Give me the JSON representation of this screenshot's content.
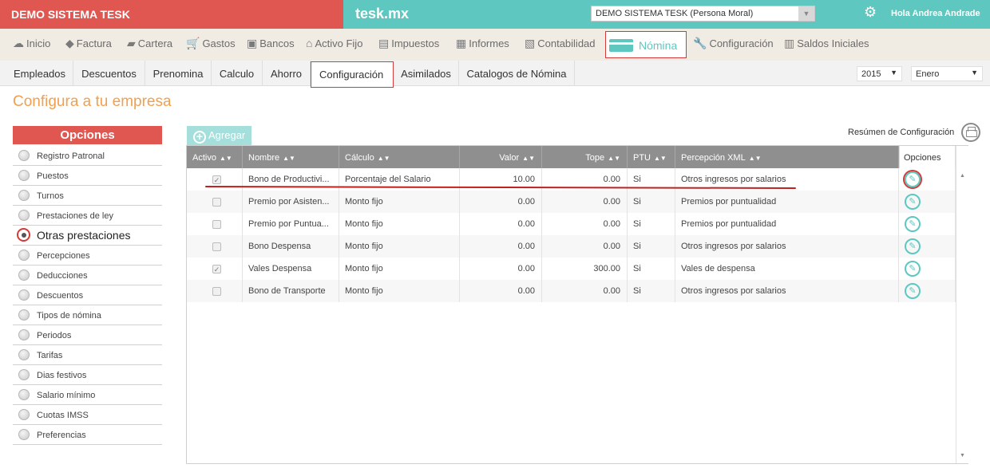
{
  "topbar": {
    "company_left": "DEMO SISTEMA TESK",
    "brand": "tesk.mx",
    "company_select": "DEMO SISTEMA TESK (Persona Moral)",
    "greeting": "Hola Andrea Andrade"
  },
  "mainmenu": [
    {
      "label": "Inicio",
      "icon": "cloud-icon"
    },
    {
      "label": "Factura",
      "icon": "tag-icon"
    },
    {
      "label": "Cartera",
      "icon": "wallet-icon"
    },
    {
      "label": "Gastos",
      "icon": "cart-icon"
    },
    {
      "label": "Bancos",
      "icon": "safe-icon"
    },
    {
      "label": "Activo Fijo",
      "icon": "house-icon"
    },
    {
      "label": "Impuestos",
      "icon": "briefcase-icon"
    },
    {
      "label": "Informes",
      "icon": "document-icon"
    },
    {
      "label": "Contabilidad",
      "icon": "ledger-icon"
    },
    {
      "label": "Nómina",
      "icon": "card-icon",
      "active": true
    },
    {
      "label": "Configuración",
      "icon": "wrench-icon"
    },
    {
      "label": "Saldos Iniciales",
      "icon": "checklist-icon"
    }
  ],
  "submenu": [
    "Empleados",
    "Descuentos",
    "Prenomina",
    "Calculo",
    "Ahorro",
    "Configuración",
    "Asimilados",
    "Catalogos de Nómina"
  ],
  "submenu_active": "Configuración",
  "year_select": "2015",
  "month_select": "Enero",
  "page_title": "Configura a tu empresa",
  "options": {
    "header": "Opciones",
    "items": [
      "Registro Patronal",
      "Puestos",
      "Turnos",
      "Prestaciones de ley",
      "Otras prestaciones",
      "Percepciones",
      "Deducciones",
      "Descuentos",
      "Tipos de nómina",
      "Periodos",
      "Tarifas",
      "Dias festivos",
      "Salario mínimo",
      "Cuotas IMSS",
      "Preferencias"
    ],
    "active": "Otras prestaciones"
  },
  "toolbar": {
    "add_label": "Agregar",
    "summary_label": "Resúmen de Configuración"
  },
  "table": {
    "headers": [
      "Activo",
      "Nombre",
      "Cálculo",
      "Valor",
      "Tope",
      "PTU",
      "Percepción XML",
      "Opciones"
    ],
    "rows": [
      {
        "activo": true,
        "nombre": "Bono de Productivi...",
        "calculo": "Porcentaje del Salario",
        "valor": "10.00",
        "tope": "0.00",
        "ptu": "Si",
        "xml": "Otros ingresos por salarios"
      },
      {
        "activo": false,
        "nombre": "Premio por Asisten...",
        "calculo": "Monto fijo",
        "valor": "0.00",
        "tope": "0.00",
        "ptu": "Si",
        "xml": "Premios por puntualidad"
      },
      {
        "activo": false,
        "nombre": "Premio por Puntua...",
        "calculo": "Monto fijo",
        "valor": "0.00",
        "tope": "0.00",
        "ptu": "Si",
        "xml": "Premios por puntualidad"
      },
      {
        "activo": false,
        "nombre": "Bono Despensa",
        "calculo": "Monto fijo",
        "valor": "0.00",
        "tope": "0.00",
        "ptu": "Si",
        "xml": "Otros ingresos por salarios"
      },
      {
        "activo": true,
        "nombre": "Vales Despensa",
        "calculo": "Monto fijo",
        "valor": "0.00",
        "tope": "300.00",
        "ptu": "Si",
        "xml": "Vales de despensa"
      },
      {
        "activo": false,
        "nombre": "Bono de Transporte",
        "calculo": "Monto fijo",
        "valor": "0.00",
        "tope": "0.00",
        "ptu": "Si",
        "xml": "Otros ingresos por salarios"
      }
    ]
  },
  "colors": {
    "red": "#e05752",
    "teal": "#5ec8c0",
    "orange": "#f0a050",
    "highlight": "#d33a3a"
  }
}
